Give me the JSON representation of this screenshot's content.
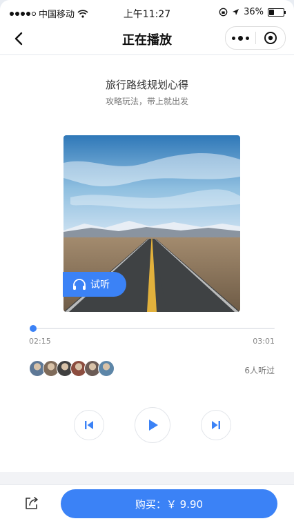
{
  "status_bar": {
    "carrier": "中国移动",
    "time": "上午11:27",
    "battery": "36%",
    "battery_level": 0.36
  },
  "nav": {
    "title": "正在播放",
    "back_icon": "chevron-left-icon",
    "more_icon": "more-dots-icon",
    "close_icon": "target-circle-icon"
  },
  "track": {
    "title": "旅行路线规划心得",
    "subtitle": "攻略玩法，带上就出发",
    "badge_label": "试听"
  },
  "progress": {
    "elapsed": "02:15",
    "total": "03:01",
    "fraction": 0.0
  },
  "listeners": {
    "count_text": "6人听过",
    "avatars": [
      "#5e7896",
      "#7f6b5a",
      "#404040",
      "#8c4d3f",
      "#6b5b55",
      "#5d86a8"
    ]
  },
  "controls": {
    "prev_icon": "skip-previous-icon",
    "play_icon": "play-icon",
    "next_icon": "skip-next-icon"
  },
  "footer": {
    "share_icon": "share-icon",
    "buy_label": "购买：￥ 9.90"
  },
  "colors": {
    "accent": "#3b82f6"
  }
}
